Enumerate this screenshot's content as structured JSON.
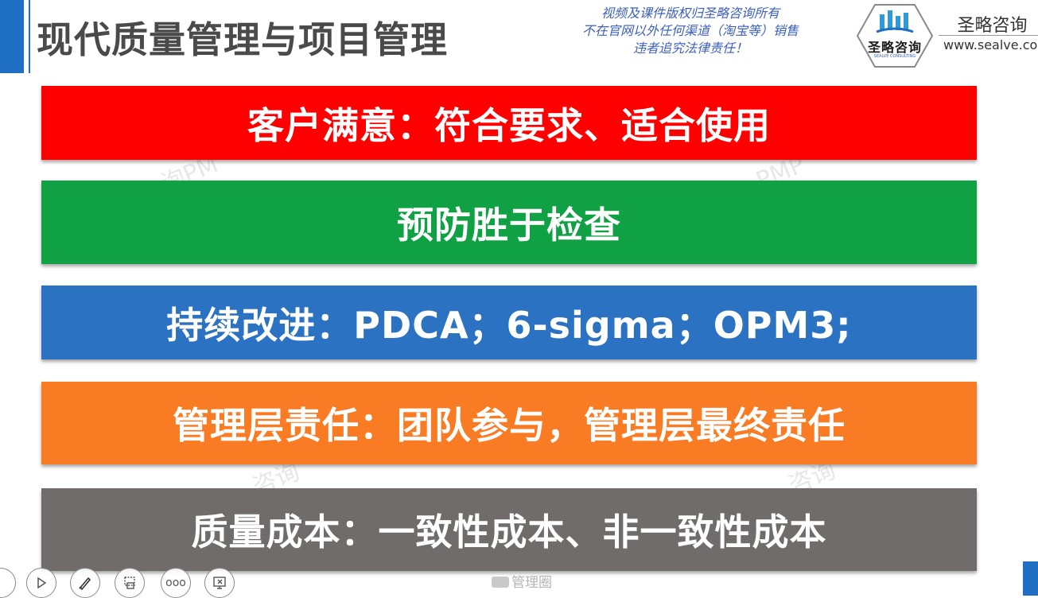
{
  "slide": {
    "title": "现代质量管理与项目管理"
  },
  "copyright": {
    "lines": [
      "视频及课件版权归圣略咨询所有",
      "不在官网以外任何渠道（淘宝等）销售",
      "违者追究法律责任！"
    ]
  },
  "logo": {
    "text": "圣略咨询",
    "subtext": "SEALVE CONSULTING",
    "brand_name": "圣略咨询",
    "url": "www.sealve.co"
  },
  "banners": [
    {
      "text": "客户满意：符合要求、适合使用",
      "color": "#fe0000"
    },
    {
      "text": "预防胜于检查",
      "color": "#10a145"
    },
    {
      "text": "持续改进：PDCA；6-sigma；OPM3;",
      "color": "#2c72c2"
    },
    {
      "text": "管理层责任：团队参与，管理层最终责任",
      "color": "#f97b24"
    },
    {
      "text": "质量成本：一致性成本、非一致性成本",
      "color": "#706c6b"
    }
  ],
  "watermarks": [
    "询PM",
    "PMP",
    "咨询",
    "咨询"
  ],
  "toolbar": {
    "more_label": "ooo"
  },
  "footer": {
    "text": "管理圈"
  },
  "colors": {
    "accent": "#1f6fc4",
    "title": "#4a4a4a",
    "copyright": "#3a5fbf"
  }
}
